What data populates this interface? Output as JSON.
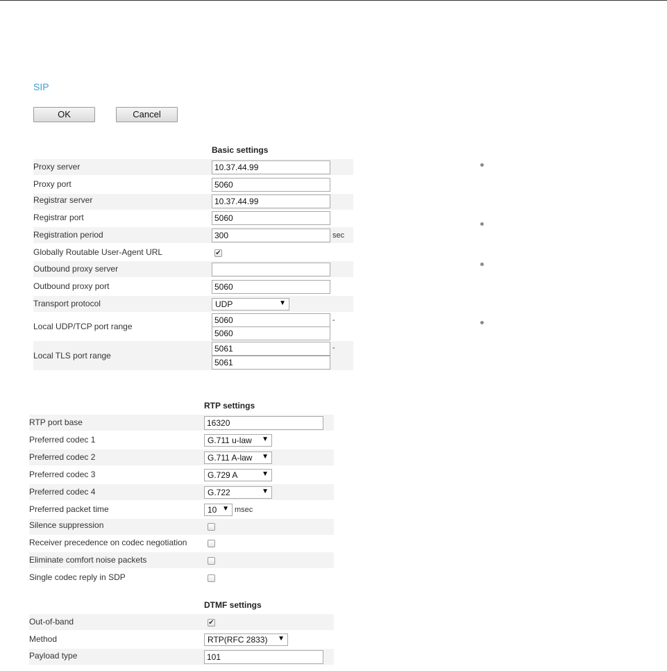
{
  "title": "SIP",
  "buttons": {
    "ok": "OK",
    "cancel": "Cancel"
  },
  "basic": {
    "heading": "Basic settings",
    "proxy_server": {
      "label": "Proxy server",
      "value": "10.37.44.99"
    },
    "proxy_port": {
      "label": "Proxy port",
      "value": "5060"
    },
    "registrar_server": {
      "label": "Registrar server",
      "value": "10.37.44.99"
    },
    "registrar_port": {
      "label": "Registrar port",
      "value": "5060"
    },
    "registration_period": {
      "label": "Registration period",
      "value": "300",
      "unit": "sec"
    },
    "gruu": {
      "label": "Globally Routable User-Agent URL",
      "checked": true
    },
    "outbound_proxy_server": {
      "label": "Outbound proxy server",
      "value": ""
    },
    "outbound_proxy_port": {
      "label": "Outbound proxy port",
      "value": "5060"
    },
    "transport": {
      "label": "Transport protocol",
      "value": "UDP"
    },
    "udp_range": {
      "label": "Local UDP/TCP port range",
      "from": "5060",
      "to": "5060",
      "sep": "-"
    },
    "tls_range": {
      "label": "Local TLS port range",
      "from": "5061",
      "to": "5061",
      "sep": "-"
    }
  },
  "rtp": {
    "heading": "RTP settings",
    "port_base": {
      "label": "RTP port base",
      "value": "16320"
    },
    "codec1": {
      "label": "Preferred codec 1",
      "value": "G.711 u-law"
    },
    "codec2": {
      "label": "Preferred codec 2",
      "value": "G.711 A-law"
    },
    "codec3": {
      "label": "Preferred codec 3",
      "value": "G.729 A"
    },
    "codec4": {
      "label": "Preferred codec 4",
      "value": "G.722"
    },
    "packet_time": {
      "label": "Preferred packet time",
      "value": "10",
      "unit": "msec"
    },
    "silence": {
      "label": "Silence suppression",
      "checked": false
    },
    "receiver_precedence": {
      "label": "Receiver precedence on codec negotiation",
      "checked": false
    },
    "comfort_noise": {
      "label": "Eliminate comfort noise packets",
      "checked": false
    },
    "single_codec": {
      "label": "Single codec reply in SDP",
      "checked": false
    }
  },
  "dtmf": {
    "heading": "DTMF settings",
    "out_of_band": {
      "label": "Out-of-band",
      "checked": true
    },
    "method": {
      "label": "Method",
      "value": "RTP(RFC 2833)"
    },
    "payload_type": {
      "label": "Payload type",
      "value": "101"
    }
  },
  "icons": {
    "dropdown": "triangle-down",
    "checkmark": "check",
    "bullet": "dot"
  },
  "colors": {
    "title": "#3aa0d8",
    "row_shade": "#f3f3f3"
  }
}
